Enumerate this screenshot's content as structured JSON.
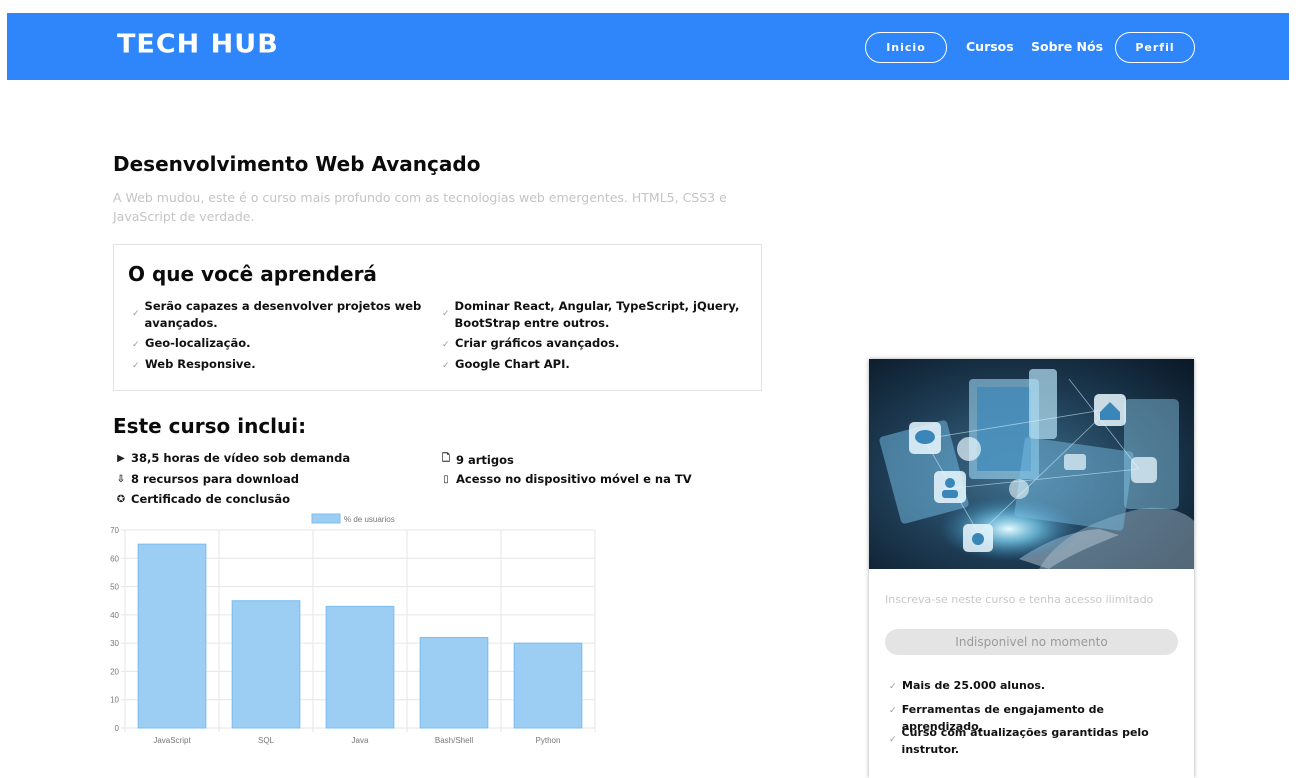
{
  "header": {
    "logo": "TECH HUB",
    "nav": {
      "inicio": "Inicio",
      "cursos": "Cursos",
      "sobre": "Sobre Nós",
      "perfil": "Perfil"
    },
    "bg_color": "#2f86fa"
  },
  "course": {
    "title": "Desenvolvimento Web Avançado",
    "description": "A Web mudou, este é o curso mais profundo com as tecnologias web emergentes. HTML5, CSS3 e JavaScript de verdade."
  },
  "learn": {
    "heading": "O que você aprenderá",
    "items": [
      "Serão capazes a desenvolver projetos web avançados.",
      "Dominar React, Angular, TypeScript, jQuery, BootStrap entre outros.",
      "Geo-localização.",
      "Criar gráficos avançados.",
      "Web Responsive.",
      "Google Chart API."
    ]
  },
  "includes": {
    "heading": "Este curso inclui:",
    "items": [
      {
        "icon": "play-icon",
        "text": "38,5 horas de vídeo sob demanda"
      },
      {
        "icon": "file-icon",
        "text": "9 artigos"
      },
      {
        "icon": "download-file-icon",
        "text": "8 recursos para download"
      },
      {
        "icon": "mobile-icon",
        "text": "Acesso no dispositivo móvel e na TV"
      },
      {
        "icon": "certificate-icon",
        "text": "Certificado de conclusão"
      }
    ]
  },
  "chart_data": {
    "type": "bar",
    "categories": [
      "JavaScript",
      "SQL",
      "Java",
      "Bash/Shell",
      "Python"
    ],
    "series": [
      {
        "name": "% de usuarios",
        "values": [
          65,
          45,
          43,
          32,
          30
        ]
      }
    ],
    "ylim": [
      0,
      70
    ],
    "yticks": [
      0,
      10,
      20,
      30,
      40,
      50,
      60,
      70
    ],
    "legend": "top",
    "grid": true,
    "bar_color": "#9ccdf3",
    "bar_border": "#7bbdf0"
  },
  "card": {
    "image_alt": "tech-network-hand-image",
    "cta": "Inscreva-se neste curso e tenha acesso ilimitado",
    "button": "Indisponivel no momento",
    "items": [
      "Mais de 25.000 alunos.",
      "Ferramentas de engajamento de aprendizado.",
      "Curso com atualizações garantidas pelo instrutor."
    ]
  }
}
